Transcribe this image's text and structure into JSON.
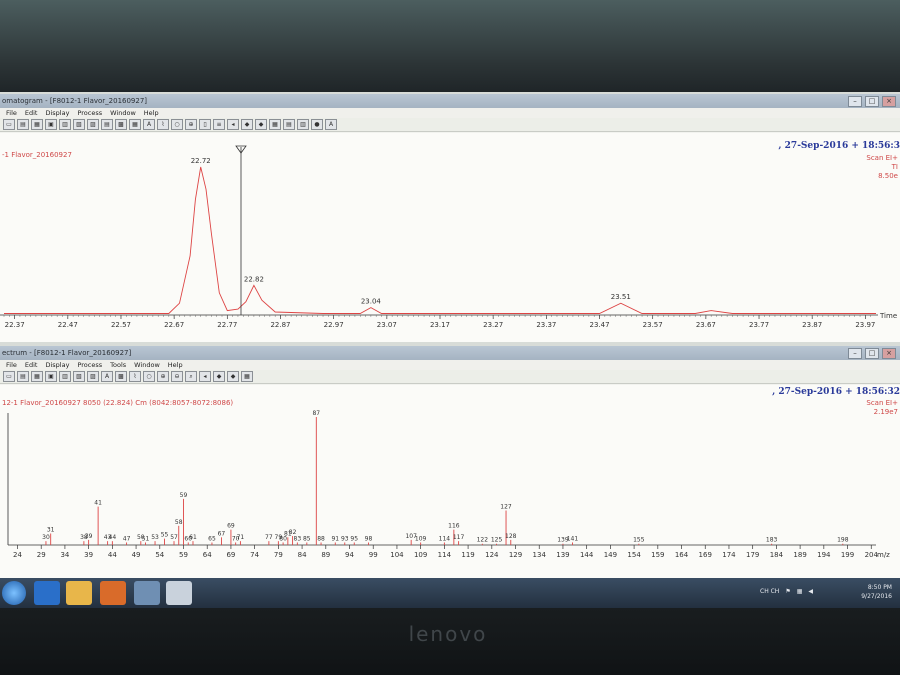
{
  "chrom_window": {
    "title": "omatogram - [F8012-1 Flavor_20160927]",
    "menu": [
      "File",
      "Edit",
      "Display",
      "Process",
      "Window",
      "Help"
    ],
    "date": ", 27-Sep-2016 + 18:56:3",
    "sample": "-1 Flavor_20160927",
    "right_labels": [
      "Scan EI+",
      "TI",
      "8.50e"
    ],
    "x_label": "Time",
    "ticks": [
      "22.37",
      "22.47",
      "22.57",
      "22.67",
      "22.77",
      "22.87",
      "22.97",
      "23.07",
      "23.17",
      "23.27",
      "23.37",
      "23.47",
      "23.57",
      "23.67",
      "23.77",
      "23.87",
      "23.97"
    ],
    "peaks": [
      {
        "rt": 22.72,
        "label": "22.72"
      },
      {
        "rt": 22.82,
        "label": "22.82"
      },
      {
        "rt": 23.04,
        "label": "23.04"
      },
      {
        "rt": 23.51,
        "label": "23.51"
      }
    ]
  },
  "spec_window": {
    "title": "ectrum - [F8012-1 Flavor_20160927]",
    "menu": [
      "File",
      "Edit",
      "Display",
      "Process",
      "Tools",
      "Window",
      "Help"
    ],
    "date": ", 27-Sep-2016 + 18:56:32",
    "sample": "12-1 Flavor_20160927 8050 (22.824) Cm (8042:8057-8072:8086)",
    "right_labels": [
      "Scan EI+",
      "2.19e7"
    ],
    "x_label": "m/z",
    "ticks": [
      "24",
      "29",
      "34",
      "39",
      "44",
      "49",
      "54",
      "59",
      "64",
      "69",
      "74",
      "79",
      "84",
      "89",
      "94",
      "99",
      "104",
      "109",
      "114",
      "119",
      "124",
      "129",
      "134",
      "139",
      "144",
      "149",
      "154",
      "159",
      "164",
      "169",
      "174",
      "179",
      "184",
      "189",
      "194",
      "199",
      "204"
    ]
  },
  "chart_data": [
    {
      "type": "line",
      "title": "",
      "xlabel": "Time",
      "ylabel": "",
      "xlim": [
        22.35,
        23.99
      ],
      "ylim": [
        0,
        100
      ],
      "x": [
        22.35,
        22.66,
        22.68,
        22.7,
        22.71,
        22.72,
        22.73,
        22.74,
        22.755,
        22.77,
        22.79,
        22.805,
        22.82,
        22.835,
        22.86,
        22.95,
        23.02,
        23.04,
        23.06,
        23.2,
        23.47,
        23.51,
        23.55,
        23.65,
        23.68,
        23.72,
        23.99
      ],
      "series": [
        {
          "values": [
            1,
            1,
            8,
            40,
            78,
            100,
            85,
            55,
            15,
            3,
            4,
            9,
            20,
            10,
            2,
            1,
            1,
            5,
            1,
            1,
            1,
            8,
            1,
            1,
            3,
            1,
            1
          ]
        }
      ]
    },
    {
      "type": "bar",
      "title": "",
      "xlabel": "m/z",
      "ylabel": "",
      "xlim": [
        22,
        205
      ],
      "ylim": [
        0,
        100
      ],
      "mz": [
        30,
        31,
        38,
        39,
        41,
        43,
        44,
        47,
        50,
        51,
        53,
        55,
        57,
        58,
        59,
        60,
        61,
        65,
        67,
        69,
        70,
        71,
        77,
        79,
        80,
        81,
        82,
        83,
        85,
        87,
        88,
        91,
        93,
        95,
        98,
        107,
        109,
        114,
        116,
        117,
        122,
        125,
        127,
        128,
        139,
        141,
        155,
        183,
        198
      ],
      "values": [
        3,
        9,
        3,
        4,
        30,
        3,
        3,
        2,
        3,
        2,
        3,
        5,
        3,
        15,
        36,
        2,
        3,
        2,
        6,
        12,
        2,
        3,
        3,
        3,
        2,
        6,
        7,
        2,
        2,
        100,
        2,
        2,
        2,
        2,
        2,
        4,
        2,
        2,
        12,
        3,
        1,
        1,
        27,
        4,
        1,
        2,
        1,
        1,
        1
      ]
    }
  ],
  "taskbar": {
    "tray_lang": "CH  CH",
    "time": "8:50 PM",
    "date": "9/27/2016"
  },
  "laptop": {
    "brand": "lenovo"
  }
}
